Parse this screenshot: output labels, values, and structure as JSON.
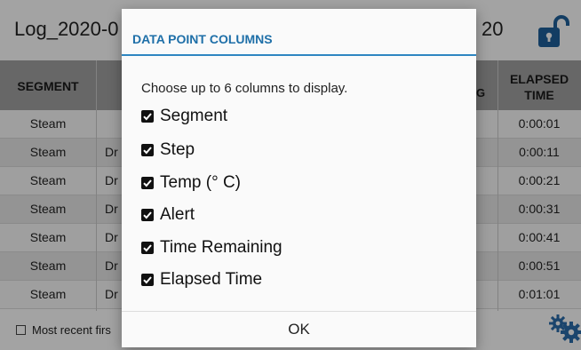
{
  "background": {
    "title_visible": "Log_2020-0",
    "title_tail_visible": "20",
    "table": {
      "headers": {
        "segment": "SEGMENT",
        "time_remaining_tail": "G",
        "elapsed_line1": "ELAPSED",
        "elapsed_line2": "TIME"
      },
      "rows": [
        {
          "segment": "Steam",
          "step": "",
          "elapsed": "0:00:01"
        },
        {
          "segment": "Steam",
          "step": "Dr",
          "elapsed": "0:00:11"
        },
        {
          "segment": "Steam",
          "step": "Dr",
          "elapsed": "0:00:21"
        },
        {
          "segment": "Steam",
          "step": "Dr",
          "elapsed": "0:00:31"
        },
        {
          "segment": "Steam",
          "step": "Dr",
          "elapsed": "0:00:41"
        },
        {
          "segment": "Steam",
          "step": "Dr",
          "elapsed": "0:00:51"
        },
        {
          "segment": "Steam",
          "step": "Dr",
          "elapsed": "0:01:01"
        }
      ]
    },
    "most_recent_first_label": "Most recent firs",
    "icons": {
      "lock": "unlocked-padlock-icon",
      "settings": "gears-icon"
    },
    "colors": {
      "header_bg": "#9e9e9e",
      "lock_blue": "#1e5f99",
      "gear_blue": "#2a6aa8"
    }
  },
  "dialog": {
    "title": "DATA POINT COLUMNS",
    "prompt": "Choose up to 6 columns to display.",
    "options": [
      {
        "label": "Segment",
        "checked": true
      },
      {
        "label": "Step",
        "checked": true
      },
      {
        "label": "Temp (° C)",
        "checked": true
      },
      {
        "label": "Alert",
        "checked": true
      },
      {
        "label": "Time Remaining",
        "checked": true
      },
      {
        "label": "Elapsed Time",
        "checked": true
      }
    ],
    "ok_label": "OK",
    "accent_color": "#2e86c1"
  }
}
